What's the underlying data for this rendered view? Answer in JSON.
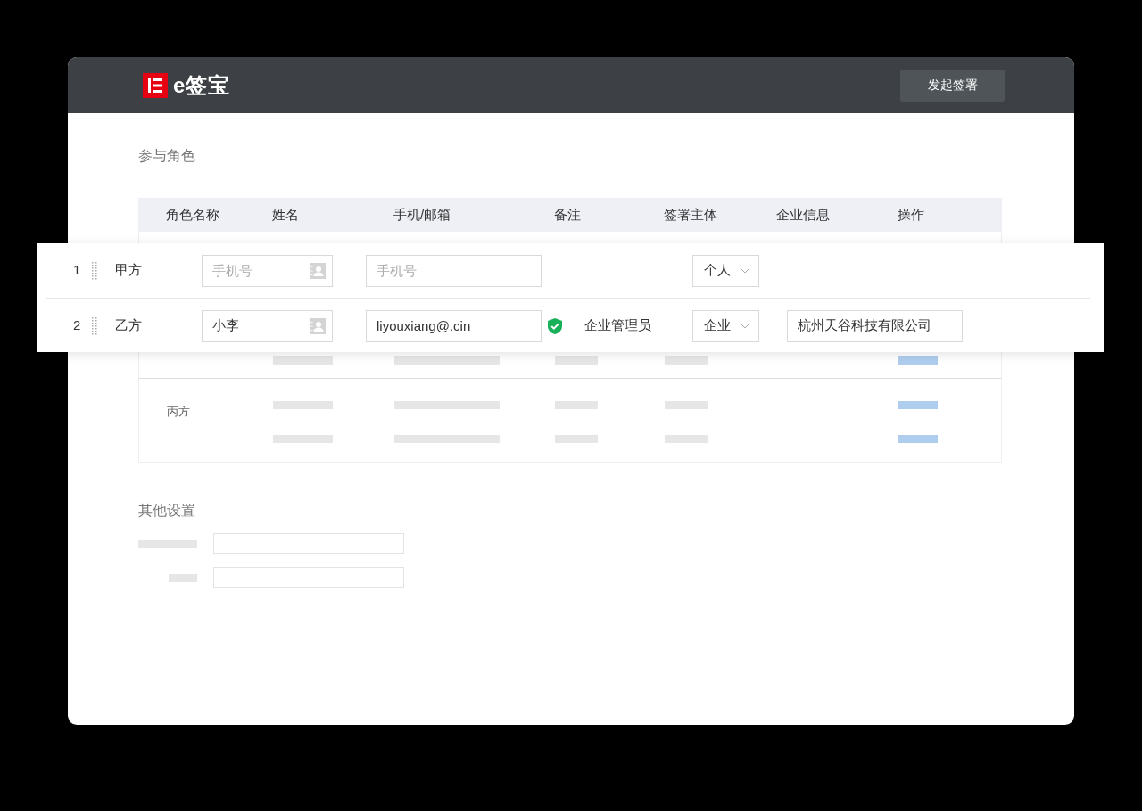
{
  "header": {
    "logo_text": "e签宝",
    "action_button": "发起签署"
  },
  "participants": {
    "title": "参与角色",
    "columns": [
      "角色名称",
      "姓名",
      "手机/邮箱",
      "备注",
      "签署主体",
      "企业信息",
      "操作"
    ],
    "editing_rows": [
      {
        "index": "1",
        "role": "甲方",
        "name": {
          "placeholder": "手机号"
        },
        "contact": {
          "placeholder": "手机号"
        },
        "verified": false,
        "subject": "个人"
      },
      {
        "index": "2",
        "role": "乙方",
        "name": {
          "value": "小李"
        },
        "contact": {
          "value": "liyouxiang@.cin"
        },
        "verified": true,
        "remark": "企业管理员",
        "subject": "企业",
        "company": {
          "value": "杭州天谷科技有限公司"
        }
      }
    ],
    "background_groups": [
      {
        "role": "丙方"
      }
    ]
  },
  "other_settings": {
    "title": "其他设置"
  }
}
